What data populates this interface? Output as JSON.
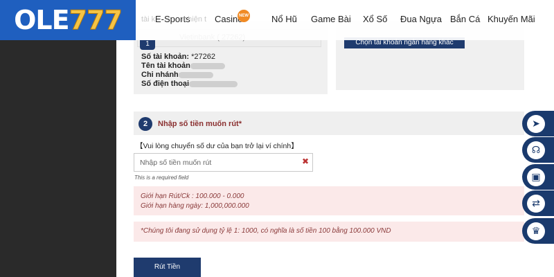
{
  "brand": {
    "logo_part1": "OLE",
    "logo_part2": "777"
  },
  "nav": {
    "items": [
      "E-Sports",
      "Casino",
      "Nổ Hũ",
      "Game Bài",
      "Xổ Số",
      "Đua Ngựa",
      "Bắn Cá",
      "Khuyến Mãi"
    ],
    "new_badge": "NEW",
    "faded_fragment_1": "tài k",
    "faded_fragment_2": "n hiện t"
  },
  "account": {
    "step_number": "1",
    "bank_name": "Vietinbank ( 27262)",
    "account_number_label": "Số tài khoản:",
    "account_number_value": " *27262",
    "holder_label": "Tên tài khoản:",
    "branch_label": "Chi nhánh:",
    "phone_label": "Số điện thoại:",
    "choose_other_button": "Chọn tài khoản ngân hàng khác"
  },
  "step2": {
    "number": "2",
    "title": "Nhập số tiền muốn rút*",
    "note": "【Vui lòng chuyển số dư của bạn trở lại ví chính】",
    "input_placeholder": "Nhập số tiền muốn rút",
    "clear_icon": "✖",
    "required_text": "This is a required field",
    "limit_per_tx": "Giới hạn Rút/Ck : 100.000 - 0.000",
    "limit_daily": "Giới hạn hàng ngày: 1,000,000.000",
    "rate_note": "*Chúng tôi đang sử dụng tỷ lệ 1: 1000, có nghĩa là số tiền 100 bằng 100.000 VND",
    "submit_label": "Rút Tiền"
  },
  "side_buttons": {
    "icons": [
      "telegram-icon",
      "headset-icon",
      "wallet-icon",
      "transfer-icon",
      "crown-icon"
    ],
    "glyphs": [
      "➤",
      "☊",
      "▣",
      "⇄",
      "♛"
    ]
  },
  "colors": {
    "brand_blue": "#1f5fbf",
    "navy": "#1f3b6e",
    "gold": "#f6c445",
    "alert_bg": "#fbe9e9",
    "alert_text": "#8a3a3a"
  }
}
